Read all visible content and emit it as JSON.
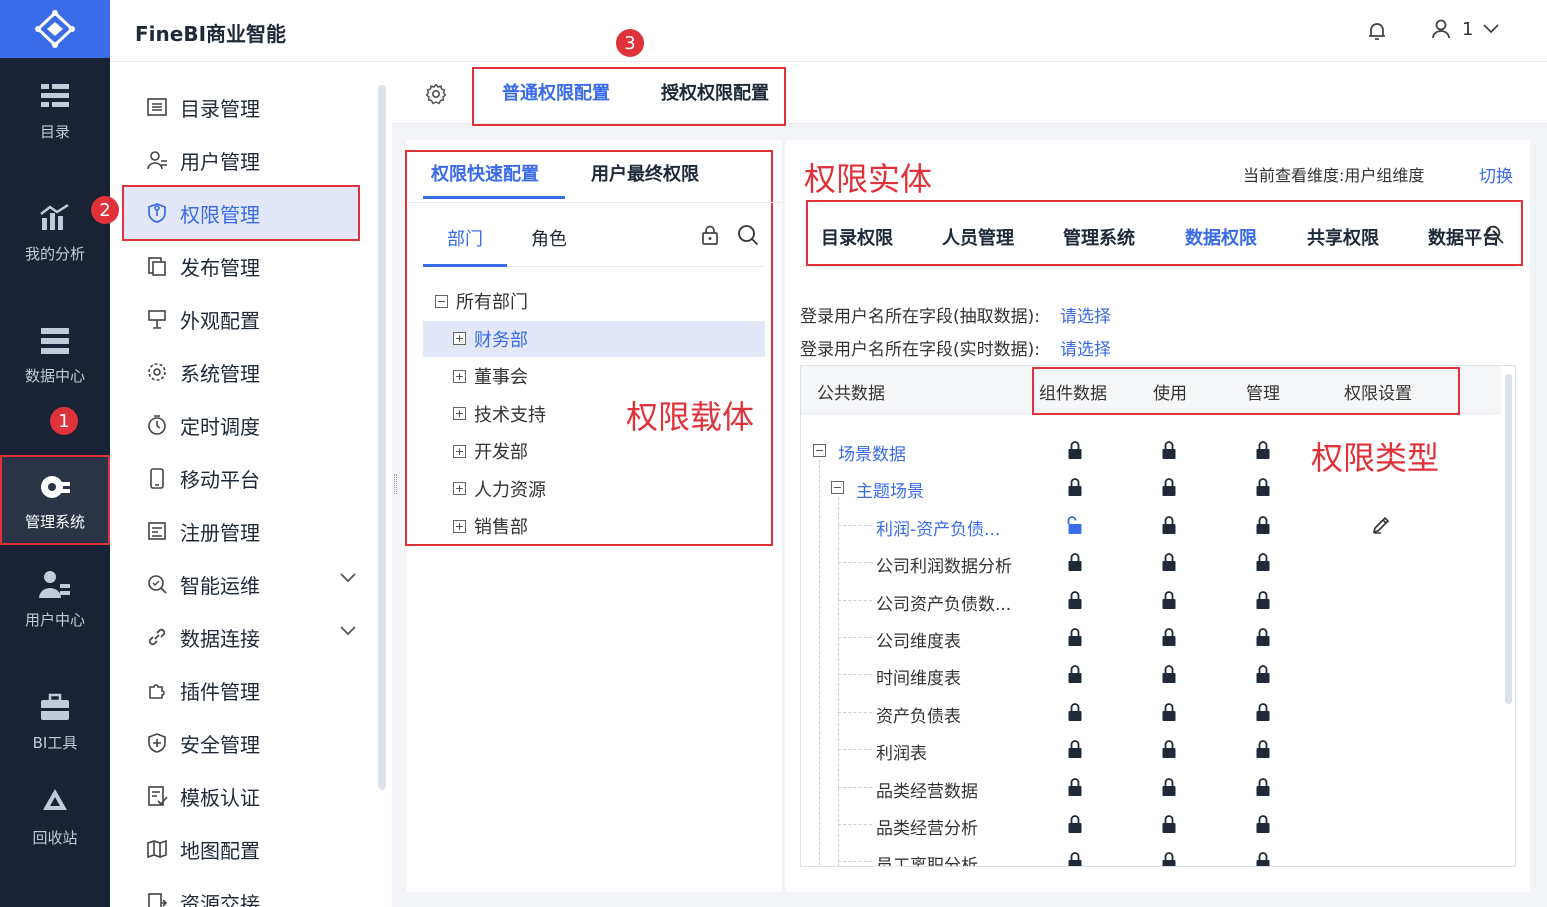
{
  "app": {
    "title": "FineBI商业智能",
    "user": "1"
  },
  "rail": {
    "items": [
      {
        "label": "目录",
        "icon": "catalog-icon"
      },
      {
        "label": "我的分析",
        "icon": "analysis-icon"
      },
      {
        "label": "数据中心",
        "icon": "data-center-icon"
      },
      {
        "label": "管理系统",
        "icon": "management-icon",
        "active": true
      },
      {
        "label": "用户中心",
        "icon": "user-center-icon"
      },
      {
        "label": "BI工具",
        "icon": "toolbox-icon"
      },
      {
        "label": "回收站",
        "icon": "recycle-icon"
      }
    ]
  },
  "sidebar": {
    "items": [
      {
        "label": "目录管理",
        "icon": "list-icon"
      },
      {
        "label": "用户管理",
        "icon": "user-icon"
      },
      {
        "label": "权限管理",
        "icon": "shield-icon",
        "active": true
      },
      {
        "label": "发布管理",
        "icon": "publish-icon"
      },
      {
        "label": "外观配置",
        "icon": "appearance-icon"
      },
      {
        "label": "系统管理",
        "icon": "gear-icon"
      },
      {
        "label": "定时调度",
        "icon": "timer-icon"
      },
      {
        "label": "移动平台",
        "icon": "mobile-icon"
      },
      {
        "label": "注册管理",
        "icon": "register-icon"
      },
      {
        "label": "智能运维",
        "icon": "ops-icon",
        "expandable": true
      },
      {
        "label": "数据连接",
        "icon": "link-icon",
        "expandable": true
      },
      {
        "label": "插件管理",
        "icon": "plugin-icon"
      },
      {
        "label": "安全管理",
        "icon": "security-icon"
      },
      {
        "label": "模板认证",
        "icon": "template-icon"
      },
      {
        "label": "地图配置",
        "icon": "map-icon"
      },
      {
        "label": "资源交接",
        "icon": "resource-icon"
      }
    ]
  },
  "top_tabs": {
    "normal": "普通权限配置",
    "grant": "授权权限配置"
  },
  "badges": {
    "one": "1",
    "two": "2",
    "three": "3"
  },
  "annotations": {
    "entity": "权限实体",
    "carrier": "权限载体",
    "type": "权限类型"
  },
  "left_panel": {
    "tabs": {
      "quick": "权限快速配置",
      "final": "用户最终权限"
    },
    "subtabs": {
      "dept": "部门",
      "role": "角色"
    },
    "tree": [
      {
        "label": "所有部门",
        "sign": "−",
        "level": 0
      },
      {
        "label": "财务部",
        "sign": "+",
        "level": 1,
        "selected": true
      },
      {
        "label": "董事会",
        "sign": "+",
        "level": 1
      },
      {
        "label": "技术支持",
        "sign": "+",
        "level": 1
      },
      {
        "label": "开发部",
        "sign": "+",
        "level": 1
      },
      {
        "label": "人力资源",
        "sign": "+",
        "level": 1
      },
      {
        "label": "销售部",
        "sign": "+",
        "level": 1
      }
    ]
  },
  "right_panel": {
    "dimension_text": "当前查看维度:用户组维度",
    "switch_label": "切换",
    "perm_tabs": [
      "目录权限",
      "人员管理",
      "管理系统",
      "数据权限",
      "共享权限",
      "数据平台"
    ],
    "active_perm_tab": 3,
    "fields": [
      {
        "label": "登录用户名所在字段(抽取数据):",
        "action": "请选择"
      },
      {
        "label": "登录用户名所在字段(实时数据):",
        "action": "请选择"
      }
    ],
    "table": {
      "headers": {
        "name": "公共数据",
        "component": "组件数据",
        "use": "使用",
        "manage": "管理",
        "setting": "权限设置"
      },
      "rows": [
        {
          "name": "场景数据",
          "kind": "root",
          "open": false
        },
        {
          "name": "主题场景",
          "kind": "group",
          "open": false
        },
        {
          "name": "利润-资产负债...",
          "kind": "leaf-active",
          "open": true,
          "editable": true
        },
        {
          "name": "公司利润数据分析",
          "kind": "leaf"
        },
        {
          "name": "公司资产负债数...",
          "kind": "leaf"
        },
        {
          "name": "公司维度表",
          "kind": "leaf"
        },
        {
          "name": "时间维度表",
          "kind": "leaf"
        },
        {
          "name": "资产负债表",
          "kind": "leaf"
        },
        {
          "name": "利润表",
          "kind": "leaf"
        },
        {
          "name": "品类经营数据",
          "kind": "leaf"
        },
        {
          "name": "品类经营分析",
          "kind": "leaf"
        },
        {
          "name": "员工离职分析",
          "kind": "leaf"
        }
      ]
    }
  },
  "colors": {
    "accent": "#3a6be8",
    "rail": "#1a2335",
    "annotation": "#e0323a",
    "selected_bg": "#e3e8f9"
  }
}
